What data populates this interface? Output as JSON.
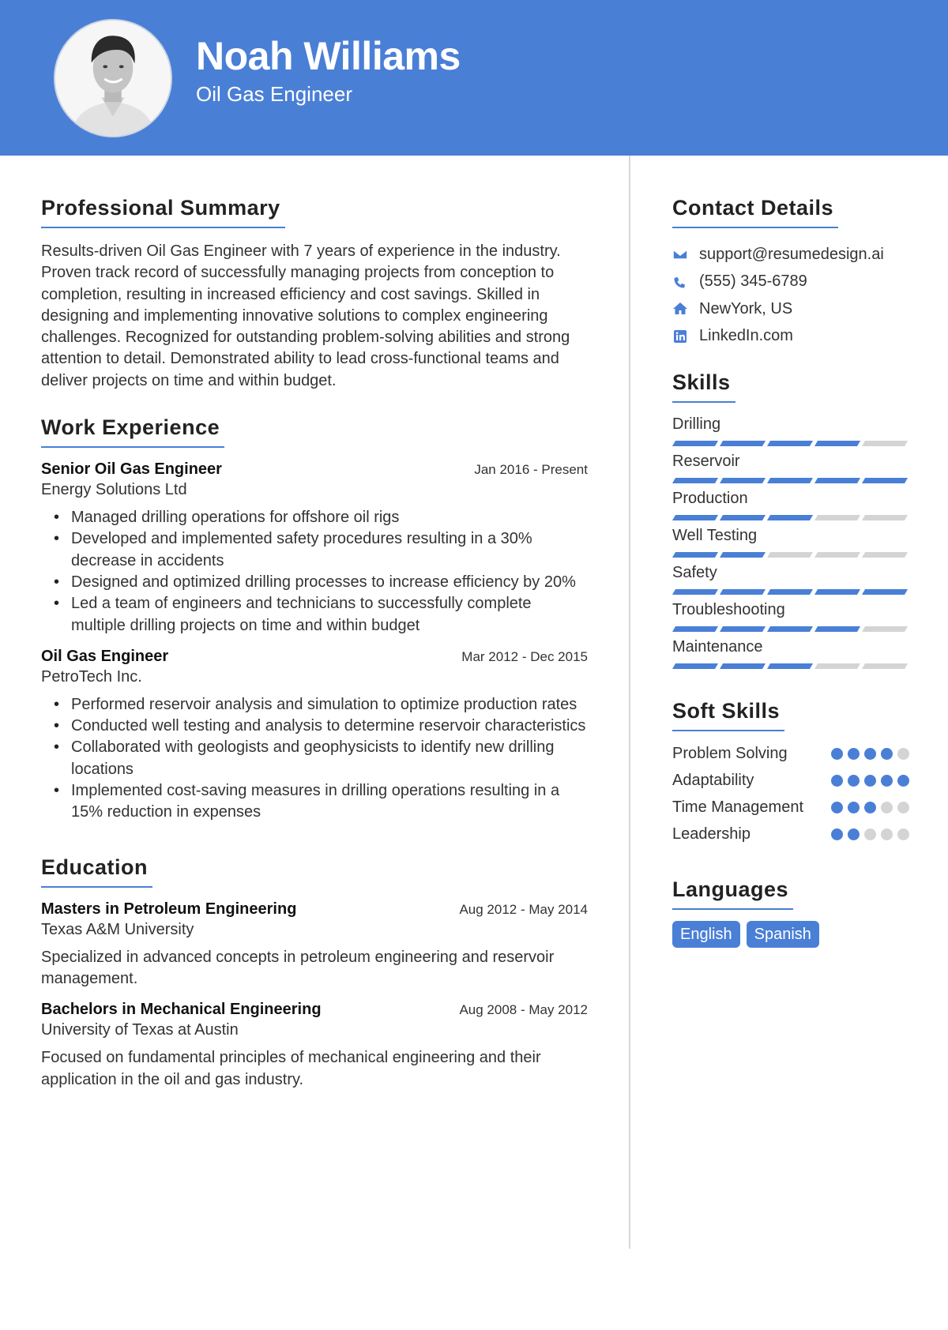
{
  "header": {
    "name": "Noah Williams",
    "title": "Oil Gas Engineer",
    "accent_color": "#4a7fd6"
  },
  "summary": {
    "heading": "Professional Summary",
    "text": "Results-driven Oil Gas Engineer with 7 years of experience in the industry. Proven track record of successfully managing projects from conception to completion, resulting in increased efficiency and cost savings. Skilled in designing and implementing innovative solutions to complex engineering challenges. Recognized for outstanding problem-solving abilities and strong attention to detail. Demonstrated ability to lead cross-functional teams and deliver projects on time and within budget."
  },
  "experience": {
    "heading": "Work Experience",
    "jobs": [
      {
        "title": "Senior Oil Gas Engineer",
        "date": "Jan 2016 - Present",
        "company": "Energy Solutions Ltd",
        "bullets": [
          "Managed drilling operations for offshore oil rigs",
          "Developed and implemented safety procedures resulting in a 30% decrease in accidents",
          "Designed and optimized drilling processes to increase efficiency by 20%",
          "Led a team of engineers and technicians to successfully complete multiple drilling projects on time and within budget"
        ]
      },
      {
        "title": "Oil Gas Engineer",
        "date": "Mar 2012 - Dec 2015",
        "company": "PetroTech Inc.",
        "bullets": [
          "Performed reservoir analysis and simulation to optimize production rates",
          "Conducted well testing and analysis to determine reservoir characteristics",
          "Collaborated with geologists and geophysicists to identify new drilling locations",
          "Implemented cost-saving measures in drilling operations resulting in a 15% reduction in expenses"
        ]
      }
    ]
  },
  "education": {
    "heading": "Education",
    "items": [
      {
        "degree": "Masters in Petroleum Engineering",
        "date": "Aug 2012 - May 2014",
        "school": "Texas A&M University",
        "description": "Specialized in advanced concepts in petroleum engineering and reservoir management."
      },
      {
        "degree": "Bachelors in Mechanical Engineering",
        "date": "Aug 2008 - May 2012",
        "school": "University of Texas at Austin",
        "description": "Focused on fundamental principles of mechanical engineering and their application in the oil and gas industry."
      }
    ]
  },
  "contact": {
    "heading": "Contact Details",
    "items": [
      {
        "icon": "envelope-icon",
        "text": "support@resumedesign.ai"
      },
      {
        "icon": "phone-icon",
        "text": "(555) 345-6789"
      },
      {
        "icon": "home-icon",
        "text": "NewYork, US"
      },
      {
        "icon": "linkedin-icon",
        "text": "LinkedIn.com"
      }
    ]
  },
  "skills": {
    "heading": "Skills",
    "max": 5,
    "items": [
      {
        "name": "Drilling",
        "level": 4
      },
      {
        "name": "Reservoir",
        "level": 5
      },
      {
        "name": "Production",
        "level": 3
      },
      {
        "name": "Well Testing",
        "level": 2
      },
      {
        "name": "Safety",
        "level": 5
      },
      {
        "name": "Troubleshooting",
        "level": 4
      },
      {
        "name": "Maintenance",
        "level": 3
      }
    ]
  },
  "soft_skills": {
    "heading": "Soft Skills",
    "max": 5,
    "items": [
      {
        "name": "Problem Solving",
        "level": 4
      },
      {
        "name": "Adaptability",
        "level": 5
      },
      {
        "name": "Time Management",
        "level": 3
      },
      {
        "name": "Leadership",
        "level": 2
      }
    ]
  },
  "languages": {
    "heading": "Languages",
    "items": [
      "English",
      "Spanish"
    ]
  }
}
